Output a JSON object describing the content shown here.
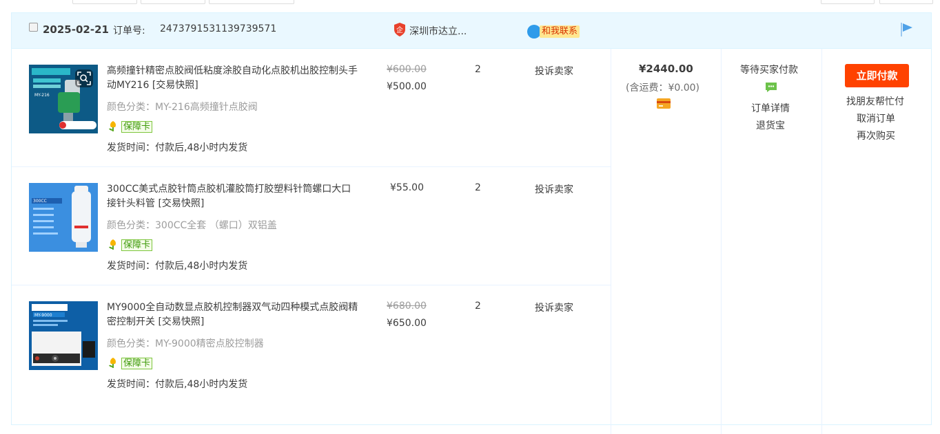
{
  "order": {
    "date": "2025-02-21",
    "order_no_label": "订单号:",
    "order_no": "2473791531139739571",
    "shop_name": "深圳市达立...",
    "contact_label": "和我联系",
    "total": "¥2440.00",
    "shipping_fee": "(含运费：¥0.00)",
    "status": "等待买家付款",
    "detail_link": "订单详情",
    "refund_link": "退货宝",
    "pay_button": "立即付款",
    "actions": [
      "找朋友帮忙付",
      "取消订单",
      "再次购买"
    ]
  },
  "items": [
    {
      "title": "高频撞针精密点胶阀低粘度涂胶自动化点胶机出胶控制头手动MY216",
      "snapshot": "[交易快照]",
      "sku": "颜色分类：MY-216高频撞针点胶阀",
      "guarantee": "保障卡",
      "shipping": "发货时间：付款后,48小时内发货",
      "original_price": "¥600.00",
      "price": "¥500.00",
      "quantity": "2",
      "complain": "投诉卖家",
      "thumb_caption": "MY-216"
    },
    {
      "title": "300CC美式点胶针筒点胶机灌胶筒打胶塑料针筒螺口大口接针头料管",
      "snapshot": "[交易快照]",
      "sku": "颜色分类：300CC全套 （螺口）双铝盖",
      "guarantee": "保障卡",
      "shipping": "发货时间：付款后,48小时内发货",
      "price": "¥55.00",
      "quantity": "2",
      "complain": "投诉卖家",
      "thumb_caption": "300CC"
    },
    {
      "title": "MY9000全自动数显点胶机控制器双气动四种模式点胶阀精密控制开关",
      "snapshot": "[交易快照]",
      "sku": "颜色分类：MY-9000精密点胶控制器",
      "guarantee": "保障卡",
      "shipping": "发货时间：付款后,48小时内发货",
      "original_price": "¥680.00",
      "price": "¥650.00",
      "quantity": "2",
      "complain": "投诉卖家",
      "thumb_caption": "MY-9000"
    }
  ],
  "icons": {
    "shop": "enterprise-shield-icon",
    "contact": "chat-bubble-icon",
    "flag": "flag-icon",
    "guarantee": "tulip-badge-icon",
    "card": "credit-card-icon",
    "chat": "message-icon",
    "image_search": "image-search-icon"
  },
  "colors": {
    "header_bg": "#eaf8ff",
    "pay_button": "#ff4200",
    "accent_blue": "#2f9bea"
  }
}
